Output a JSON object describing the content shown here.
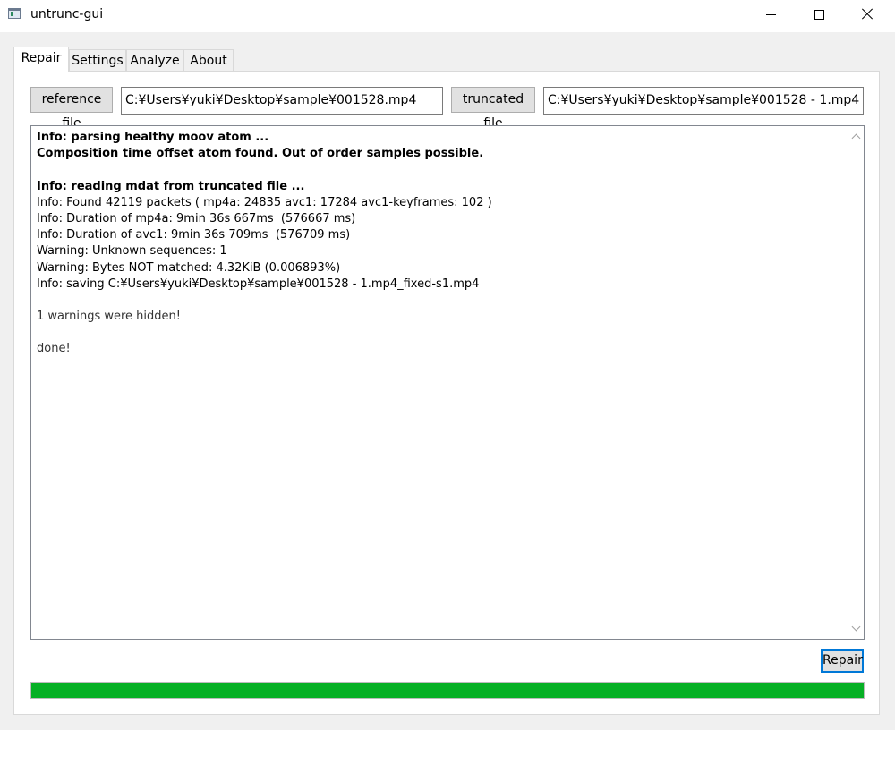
{
  "window": {
    "title": "untrunc-gui",
    "icon": "app-window-icon"
  },
  "tabs": [
    {
      "label": "Repair",
      "active": true
    },
    {
      "label": "Settings",
      "active": false
    },
    {
      "label": "Analyze",
      "active": false
    },
    {
      "label": "About",
      "active": false
    }
  ],
  "repair": {
    "reference_button": "reference file",
    "reference_path": "C:¥Users¥yuki¥Desktop¥sample¥001528.mp4",
    "truncated_button": "truncated file",
    "truncated_path": "C:¥Users¥yuki¥Desktop¥sample¥001528 - 1.mp4",
    "log_lines": [
      {
        "text": "Info: parsing healthy moov atom ...",
        "style": "bold"
      },
      {
        "text": "Composition time offset atom found. Out of order samples possible.",
        "style": "bold"
      },
      {
        "text": "",
        "style": "normal"
      },
      {
        "text": "Info: reading mdat from truncated file ...",
        "style": "bold"
      },
      {
        "text": "Info: Found 42119 packets ( mp4a: 24835 avc1: 17284 avc1-keyframes: 102 )",
        "style": "normal"
      },
      {
        "text": "Info: Duration of mp4a: 9min 36s 667ms  (576667 ms)",
        "style": "normal"
      },
      {
        "text": "Info: Duration of avc1: 9min 36s 709ms  (576709 ms)",
        "style": "normal"
      },
      {
        "text": "Warning: Unknown sequences: 1",
        "style": "normal"
      },
      {
        "text": "Warning: Bytes NOT matched: 4.32KiB (0.006893%)",
        "style": "normal"
      },
      {
        "text": "Info: saving C:¥Users¥yuki¥Desktop¥sample¥001528 - 1.mp4_fixed-s1.mp4",
        "style": "normal"
      },
      {
        "text": "",
        "style": "normal"
      },
      {
        "text": "1 warnings were hidden!",
        "style": "dim"
      },
      {
        "text": "",
        "style": "normal"
      },
      {
        "text": "done!",
        "style": "dim"
      }
    ],
    "repair_button": "Repair",
    "progress": 1.0,
    "progress_color": "#06b025"
  }
}
